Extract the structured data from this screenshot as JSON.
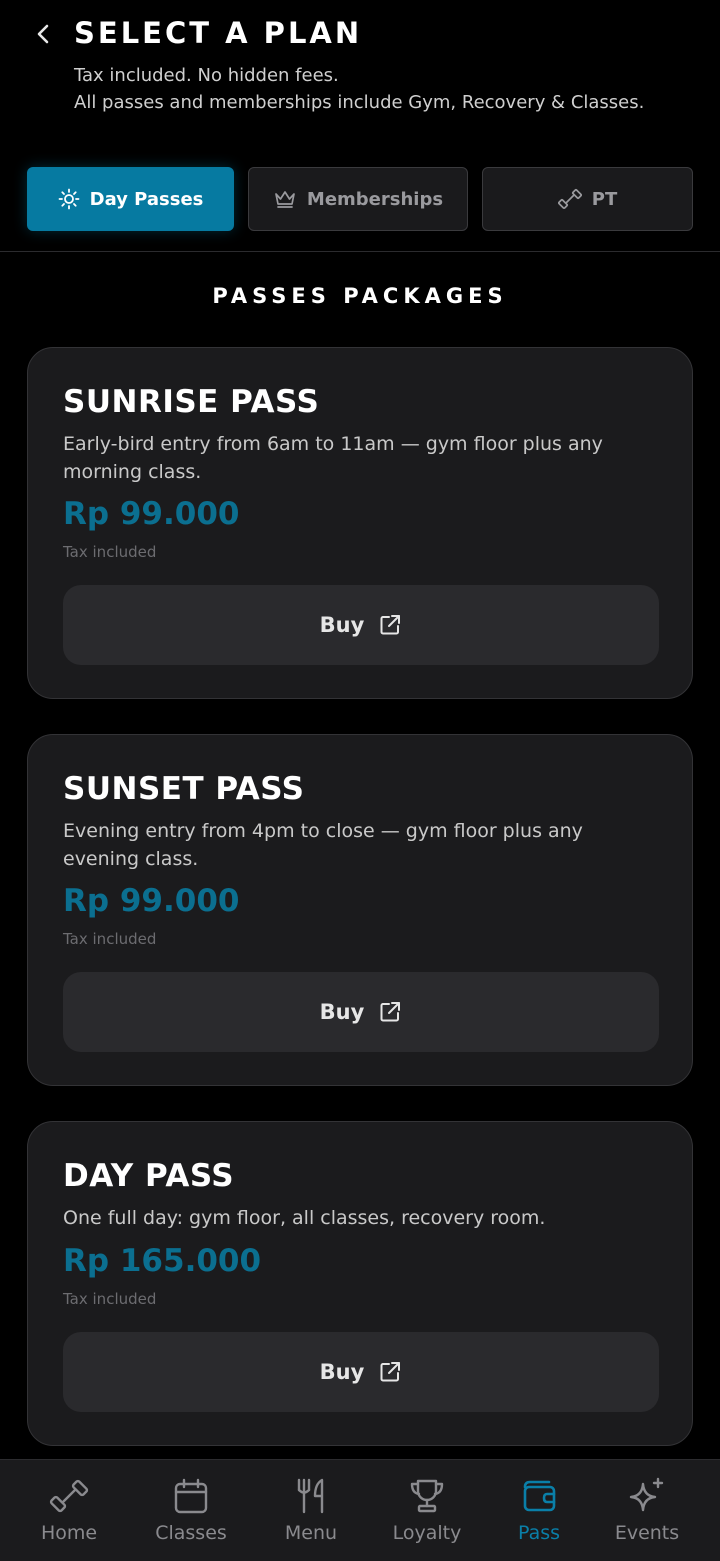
{
  "header": {
    "title": "SELECT A PLAN",
    "subtitle_line1": "Tax included. No hidden fees.",
    "subtitle_line2": "All passes and memberships include Gym, Recovery & Classes."
  },
  "tabs": [
    {
      "label": "Day Passes",
      "icon": "sun-icon",
      "active": true
    },
    {
      "label": "Memberships",
      "icon": "crown-icon",
      "active": false
    },
    {
      "label": "PT",
      "icon": "dumbbell-icon",
      "active": false
    }
  ],
  "section_title": "PASSES PACKAGES",
  "cards": [
    {
      "title": "SUNRISE PASS",
      "description": "Early-bird entry from 6am to 11am — gym floor plus any morning class.",
      "price": "Rp 99.000",
      "tax_note": "Tax included",
      "button_label": "Buy"
    },
    {
      "title": "SUNSET PASS",
      "description": "Evening entry from 4pm to close — gym floor plus any evening class.",
      "price": "Rp 99.000",
      "tax_note": "Tax included",
      "button_label": "Buy"
    },
    {
      "title": "DAY PASS",
      "description": "One full day: gym floor, all classes, recovery room.",
      "price": "Rp 165.000",
      "tax_note": "Tax included",
      "button_label": "Buy"
    }
  ],
  "bottom_nav": [
    {
      "label": "Home",
      "icon": "dumbbell-icon",
      "active": false
    },
    {
      "label": "Classes",
      "icon": "calendar-icon",
      "active": false
    },
    {
      "label": "Menu",
      "icon": "fork-knife-icon",
      "active": false
    },
    {
      "label": "Loyalty",
      "icon": "trophy-icon",
      "active": false
    },
    {
      "label": "Pass",
      "icon": "wallet-icon",
      "active": true
    },
    {
      "label": "Events",
      "icon": "sparkle-icon",
      "active": false
    }
  ],
  "colors": {
    "accent": "#067aa1",
    "price": "#0b6f90",
    "card_bg": "#1b1b1d",
    "background": "#000000"
  }
}
